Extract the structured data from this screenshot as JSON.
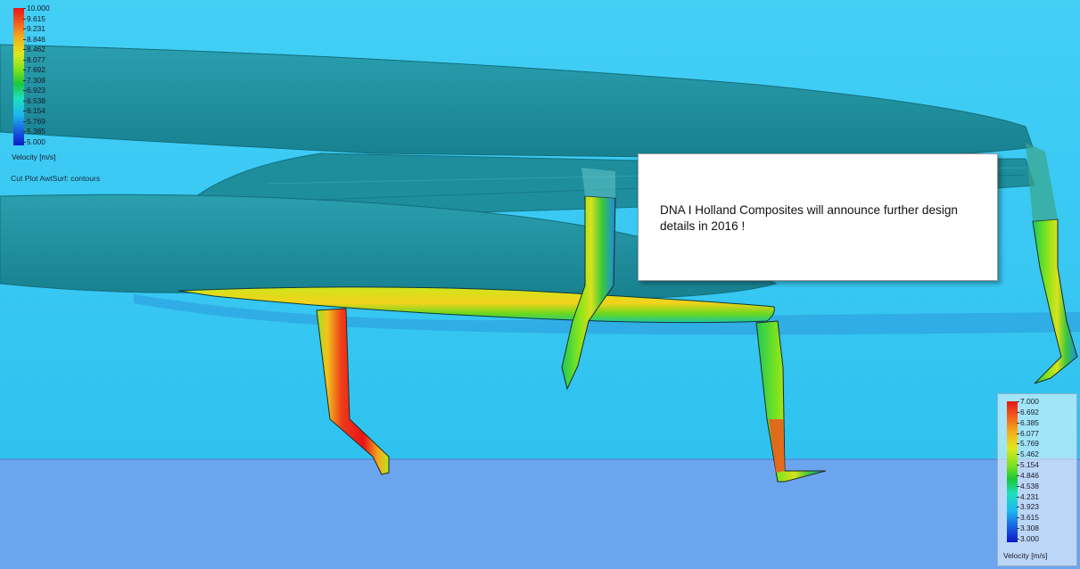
{
  "legend_top": {
    "ticks": [
      "10.000",
      "9.615",
      "9.231",
      "8.846",
      "8.462",
      "8.077",
      "7.692",
      "7.308",
      "6.923",
      "6.538",
      "6.154",
      "5.769",
      "5.385",
      "5.000"
    ],
    "unit": "Velocity [m/s]"
  },
  "legend_bottom": {
    "ticks": [
      "7.000",
      "6.692",
      "6.385",
      "6.077",
      "5.769",
      "5.462",
      "5.154",
      "4.846",
      "4.538",
      "4.231",
      "3.923",
      "3.615",
      "3.308",
      "3.000"
    ],
    "unit": "Velocity [m/s]"
  },
  "plot_title": "Cut Plot AwtSurf: contours",
  "note": "DNA I Holland Composites will announce further design details in 2016 !",
  "colors": {
    "sky": "#3ec9f2",
    "water_surface": "#6aa4ee",
    "hull": "#1f8a9a",
    "high_velocity": "#e8141a",
    "low_velocity": "#0c1aca"
  }
}
